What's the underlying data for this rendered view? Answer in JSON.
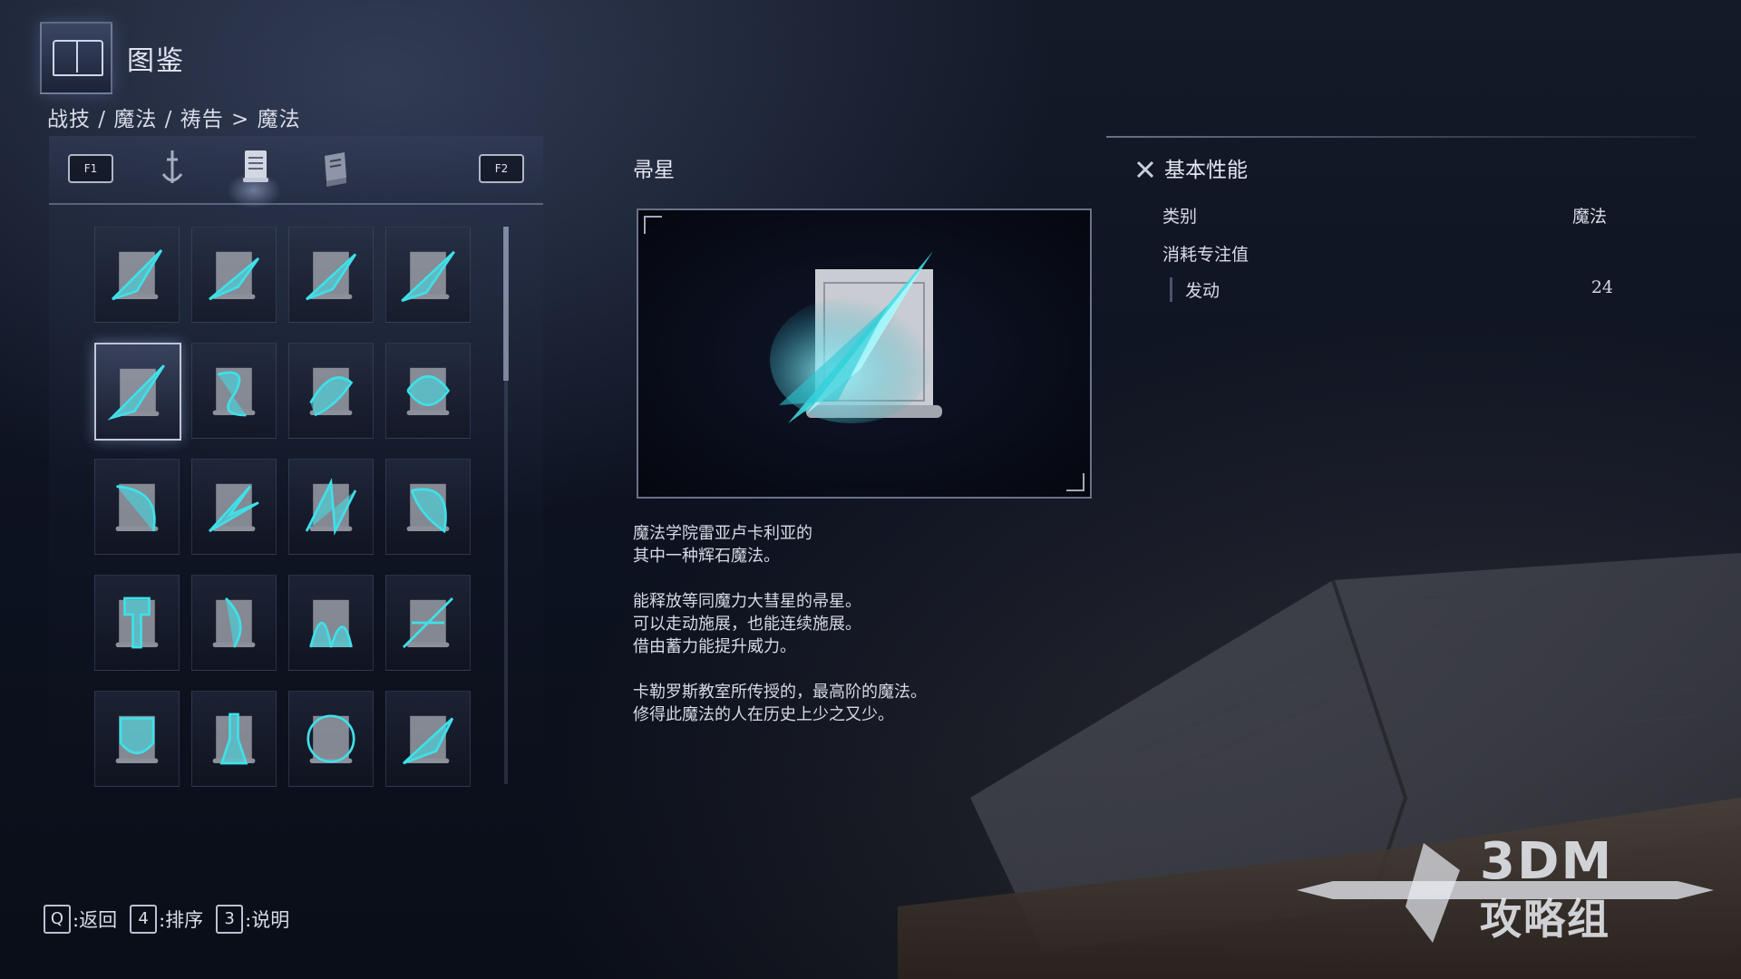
{
  "header": {
    "title": "图鉴",
    "breadcrumb": "战技 / 魔法 / 祷告 > 魔法"
  },
  "tabs": {
    "prev_key": "F1",
    "next_key": "F2",
    "items": [
      {
        "icon": "ash-of-war-icon",
        "active": false
      },
      {
        "icon": "sorcery-scroll-icon",
        "active": true
      },
      {
        "icon": "incantation-book-icon",
        "active": false
      }
    ]
  },
  "grid": {
    "selected_index": 4,
    "items": [
      {
        "icon": "glintstone-pebble-scroll-icon"
      },
      {
        "icon": "glintstone-arc-scroll-icon"
      },
      {
        "icon": "glintstone-stars-scroll-icon"
      },
      {
        "icon": "crystal-barrage-scroll-icon"
      },
      {
        "icon": "comet-scroll-icon"
      },
      {
        "icon": "shard-spiral-scroll-icon"
      },
      {
        "icon": "swift-glintstone-scroll-icon"
      },
      {
        "icon": "spiral-sorcery-scroll-icon"
      },
      {
        "icon": "glintblade-scroll-icon"
      },
      {
        "icon": "crystal-release-scroll-icon"
      },
      {
        "icon": "shatter-earth-scroll-icon"
      },
      {
        "icon": "rock-sling-scroll-icon"
      },
      {
        "icon": "hammer-sorcery-scroll-icon"
      },
      {
        "icon": "great-glintstone-shard-scroll-icon"
      },
      {
        "icon": "burst-sorcery-scroll-icon"
      },
      {
        "icon": "blade-sorcery-scroll-icon"
      },
      {
        "icon": "shield-sorcery-scroll-icon"
      },
      {
        "icon": "phantom-sorcery-scroll-icon"
      },
      {
        "icon": "vortex-sorcery-scroll-icon"
      },
      {
        "icon": "meteor-sorcery-scroll-icon"
      }
    ]
  },
  "detail": {
    "name": "帚星",
    "preview_icon": "comet-scroll-icon",
    "description": [
      "魔法学院雷亚卢卡利亚的\n其中一种辉石魔法。",
      "能释放等同魔力大彗星的帚星。\n可以走动施展，也能连续施展。\n借由蓄力能提升威力。",
      "卡勒罗斯教室所传授的，最高阶的魔法。\n修得此魔法的人在历史上少之又少。"
    ]
  },
  "stats": {
    "header": "基本性能",
    "category_label": "类别",
    "category_value": "魔法",
    "fp_label": "消耗专注值",
    "cast_label": "发动",
    "cast_value": "24"
  },
  "footer": {
    "hints": [
      {
        "key": "Q",
        "label": ":返回"
      },
      {
        "key": "4",
        "label": ":排序"
      },
      {
        "key": "3",
        "label": ":说明"
      }
    ]
  },
  "watermark": {
    "line1": "3DM",
    "line2": "攻略组"
  },
  "colors": {
    "accent_glow": "#3fe0e8",
    "panel_border": "#aeb6c8",
    "text": "#d8dce6"
  }
}
